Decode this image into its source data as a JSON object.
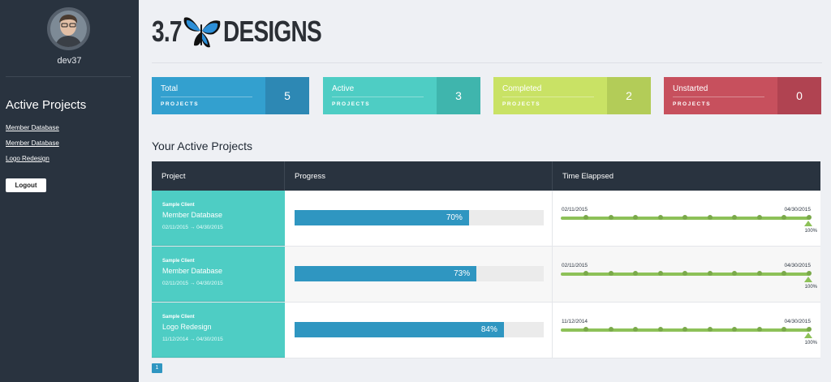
{
  "sidebar": {
    "username": "dev37",
    "heading": "Active Projects",
    "links": [
      "Member Database",
      "Member Database",
      "Logo Redesign"
    ],
    "logout_label": "Logout"
  },
  "logo": {
    "number": "3.7",
    "word": "DESIGNS",
    "icon": "butterfly-icon"
  },
  "stats": [
    {
      "title": "Total",
      "sub": "PROJECTS",
      "value": "5",
      "color": "#33a0cf",
      "num_color": "#2d88b4"
    },
    {
      "title": "Active",
      "sub": "PROJECTS",
      "value": "3",
      "color": "#4ecdc4",
      "num_color": "#3fb5ad"
    },
    {
      "title": "Completed",
      "sub": "PROJECTS",
      "value": "2",
      "color": "#c9e265",
      "num_color": "#b3cc58"
    },
    {
      "title": "Unstarted",
      "sub": "PROJECTS",
      "value": "0",
      "color": "#c7505d",
      "num_color": "#b04351"
    }
  ],
  "section_title": "Your Active Projects",
  "table": {
    "headers": [
      "Project",
      "Progress",
      "Time Elappsed"
    ],
    "rows": [
      {
        "client": "Sample Client",
        "name": "Member Database",
        "dates": "02/11/2015  →  04/30/2015",
        "progress": 70,
        "progress_label": "70%",
        "start": "02/11/2015",
        "end": "04/30/2015",
        "elapsed_label": "100%"
      },
      {
        "client": "Sample Client",
        "name": "Member Database",
        "dates": "02/11/2015  →  04/30/2015",
        "progress": 73,
        "progress_label": "73%",
        "start": "02/11/2015",
        "end": "04/30/2015",
        "elapsed_label": "100%"
      },
      {
        "client": "Sample Client",
        "name": "Logo Redesign",
        "dates": "11/12/2014  →  04/30/2015",
        "progress": 84,
        "progress_label": "84%",
        "start": "11/12/2014",
        "end": "04/30/2015",
        "elapsed_label": "100%"
      }
    ]
  },
  "pagination": {
    "current": "1"
  }
}
